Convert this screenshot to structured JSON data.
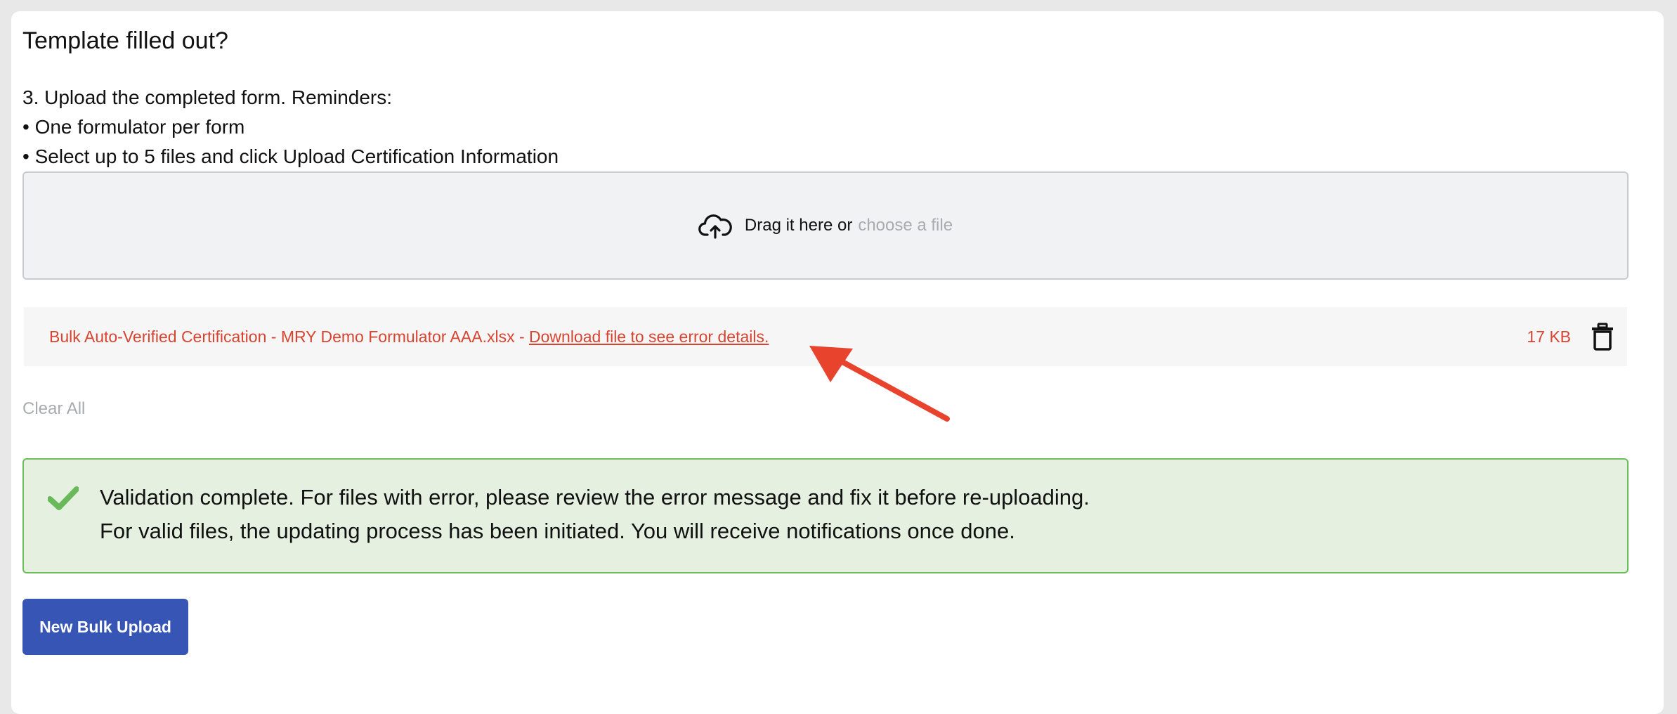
{
  "page": {
    "title": "Template filled out?"
  },
  "instructions": {
    "step": "3. Upload the completed form. Reminders:",
    "bullets": [
      "• One formulator per form",
      "• Select up to 5 files and click Upload Certification Information"
    ]
  },
  "dropzone": {
    "icon": "cloud-upload-icon",
    "drag_text": "Drag it here or",
    "choose_link": "choose a file"
  },
  "file": {
    "name": "Bulk Auto-Verified Certification - MRY Demo Formulator AAA.xlsx - ",
    "error_link": "Download file to see error details.",
    "size": "17 KB",
    "delete_icon": "trash-icon",
    "color": "#d64531"
  },
  "clear_all": "Clear All",
  "alert": {
    "icon": "check-icon",
    "line1": "Validation complete. For files with error, please review the error message and fix it before re-uploading.",
    "line2": "For valid files, the updating process has been initiated. You will receive notifications once done.",
    "bg_color": "#e5f0e1",
    "border_color": "#6abf5b"
  },
  "button": {
    "label": "New Bulk Upload",
    "color": "#3655b5"
  },
  "annotation": {
    "icon": "arrow-icon",
    "color": "#e8432c"
  }
}
